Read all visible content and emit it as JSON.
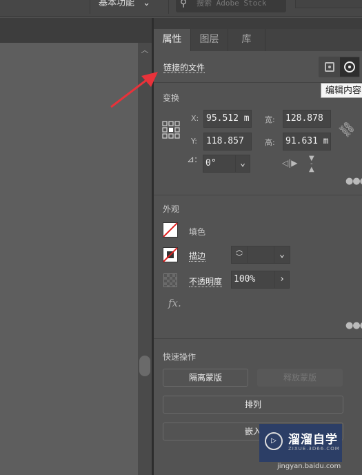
{
  "topbar": {
    "workspace": "基本功能",
    "search_placeholder": "搜索 Adobe Stock"
  },
  "tabs": [
    {
      "label": "属性",
      "active": true
    },
    {
      "label": "图层"
    },
    {
      "label": "库"
    }
  ],
  "linked_file": {
    "label": "链接的文件",
    "tooltip": "编辑内容"
  },
  "transform": {
    "title": "变换",
    "x_label": "X:",
    "x": "95.512 m",
    "y_label": "Y:",
    "y": "118.857",
    "w_label": "宽:",
    "w": "128.878",
    "h_label": "高:",
    "h": "91.631 m",
    "angle": "0°"
  },
  "appearance": {
    "title": "外观",
    "fill": "填色",
    "stroke": "描边",
    "opacity_label": "不透明度",
    "opacity": "100%",
    "fx": "fx."
  },
  "quick_actions": {
    "title": "快速操作",
    "isolate_mask": "隔离蒙版",
    "release_mask": "释放蒙版",
    "arrange": "排列",
    "embed": "嵌入"
  },
  "watermark": {
    "name": "溜溜自学",
    "url": "ZIXUE.3D66.COM",
    "footer": "jingyan.baidu.com"
  },
  "colors": {
    "accent_arrow": "#e8323a",
    "none_slash": "#e0201f"
  }
}
